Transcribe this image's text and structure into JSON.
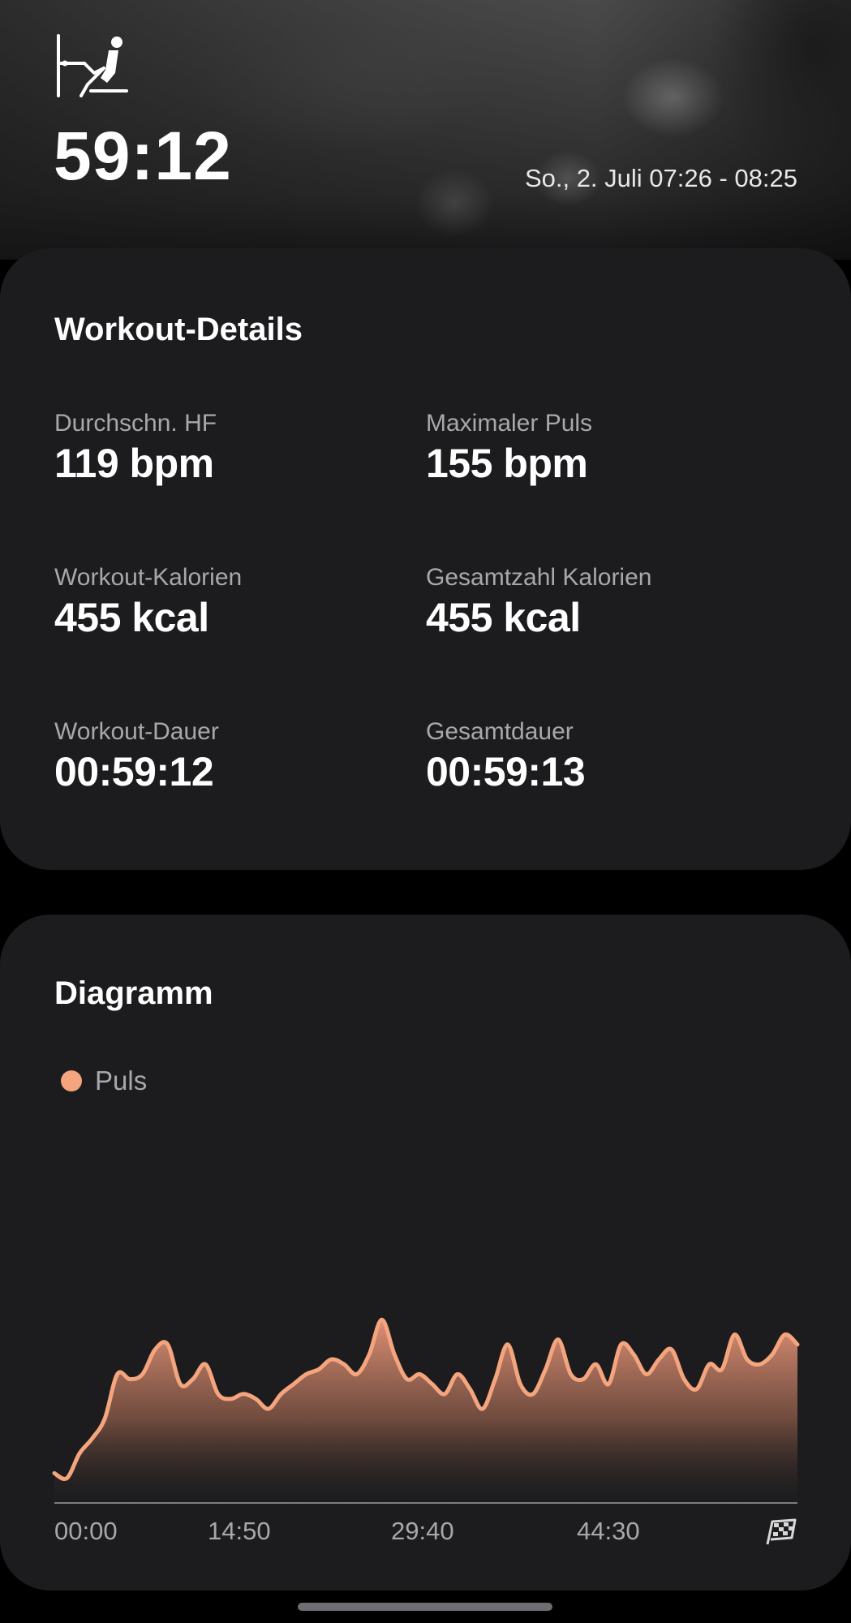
{
  "header": {
    "workout_icon": "rowing-machine-icon",
    "duration": "59:12",
    "date_range": "So., 2. Juli 07:26 - 08:25"
  },
  "details": {
    "title": "Workout-Details",
    "stats": [
      {
        "label": "Durchschn. HF",
        "value": "119 bpm"
      },
      {
        "label": "Maximaler Puls",
        "value": "155 bpm"
      },
      {
        "label": "Workout-Kalorien",
        "value": "455 kcal"
      },
      {
        "label": "Gesamtzahl Kalorien",
        "value": "455 kcal"
      },
      {
        "label": "Workout-Dauer",
        "value": "00:59:12"
      },
      {
        "label": "Gesamtdauer",
        "value": "00:59:13"
      }
    ]
  },
  "chart": {
    "title": "Diagramm",
    "legend_label": "Puls",
    "finish_icon": "checkered-flag-icon"
  },
  "chart_data": {
    "type": "area",
    "title": "Diagramm",
    "series": [
      {
        "name": "Puls",
        "color": "#f4a57d",
        "x": [
          0,
          1,
          2,
          3,
          4,
          5,
          6,
          7,
          8,
          9,
          10,
          11,
          12,
          13,
          14,
          15,
          16,
          17,
          18,
          19,
          20,
          21,
          22,
          23,
          24,
          25,
          26,
          27,
          28,
          29,
          30,
          31,
          32,
          33,
          34,
          35,
          36,
          37,
          38,
          39,
          40,
          41,
          42,
          43,
          44,
          45,
          46,
          47,
          48,
          49,
          50,
          51,
          52,
          53,
          54,
          55,
          56,
          57,
          58,
          59
        ],
        "values": [
          72,
          70,
          80,
          86,
          94,
          112,
          110,
          112,
          122,
          124,
          108,
          110,
          116,
          104,
          102,
          104,
          102,
          98,
          104,
          108,
          112,
          114,
          118,
          116,
          112,
          120,
          134,
          120,
          110,
          112,
          108,
          104,
          112,
          106,
          98,
          110,
          124,
          108,
          104,
          114,
          126,
          112,
          110,
          116,
          108,
          124,
          120,
          112,
          118,
          122,
          110,
          106,
          116,
          114,
          128,
          118,
          116,
          120,
          128,
          124
        ]
      }
    ],
    "x_ticks": [
      "00:00",
      "14:50",
      "29:40",
      "44:30"
    ],
    "ylim": [
      60,
      160
    ],
    "grid": false,
    "legend": "top-left"
  }
}
